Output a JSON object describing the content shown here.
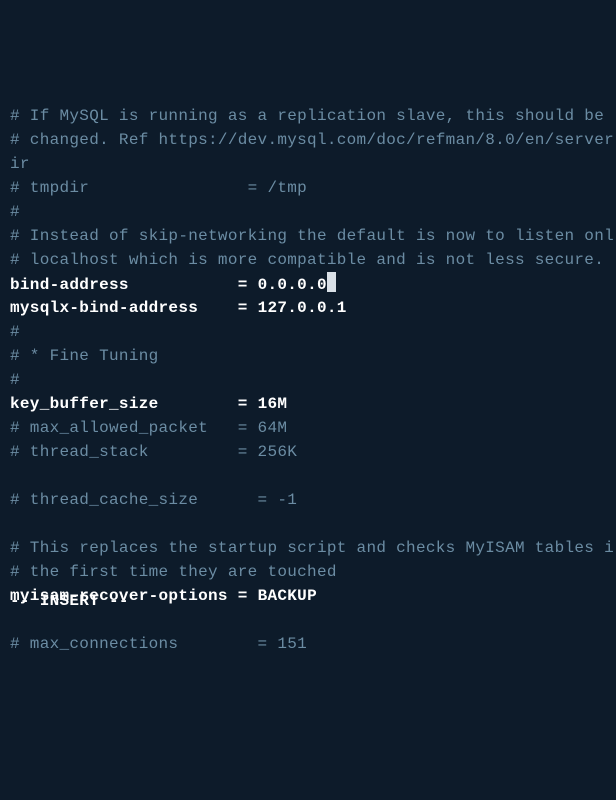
{
  "lines": [
    {
      "type": "comment",
      "text": "# If MySQL is running as a replication slave, this should be "
    },
    {
      "type": "comment",
      "text": "# changed. Ref https://dev.mysql.com/doc/refman/8.0/en/server"
    },
    {
      "type": "comment",
      "text": "ir"
    },
    {
      "type": "comment",
      "text": "# tmpdir                = /tmp"
    },
    {
      "type": "comment",
      "text": "#"
    },
    {
      "type": "comment",
      "text": "# Instead of skip-networking the default is now to listen onl"
    },
    {
      "type": "comment",
      "text": "# localhost which is more compatible and is not less secure."
    },
    {
      "type": "active-cursor",
      "key": "bind-address           ",
      "eq": "= ",
      "val": "0.0.0.0"
    },
    {
      "type": "active",
      "key": "mysqlx-bind-address    ",
      "eq": "= ",
      "val": "127.0.0.1"
    },
    {
      "type": "comment",
      "text": "#"
    },
    {
      "type": "comment",
      "text": "# * Fine Tuning"
    },
    {
      "type": "comment",
      "text": "#"
    },
    {
      "type": "active",
      "key": "key_buffer_size        ",
      "eq": "= ",
      "val": "16M"
    },
    {
      "type": "comment",
      "text": "# max_allowed_packet   = 64M"
    },
    {
      "type": "comment",
      "text": "# thread_stack         = 256K"
    },
    {
      "type": "blank",
      "text": ""
    },
    {
      "type": "comment",
      "text": "# thread_cache_size      = -1"
    },
    {
      "type": "blank",
      "text": ""
    },
    {
      "type": "comment",
      "text": "# This replaces the startup script and checks MyISAM tables i"
    },
    {
      "type": "comment",
      "text": "# the first time they are touched"
    },
    {
      "type": "active",
      "key": "myisam-recover-options ",
      "eq": "= ",
      "val": "BACKUP"
    },
    {
      "type": "blank",
      "text": ""
    },
    {
      "type": "comment",
      "text": "# max_connections        = 151"
    }
  ],
  "status": "-- INSERT --"
}
